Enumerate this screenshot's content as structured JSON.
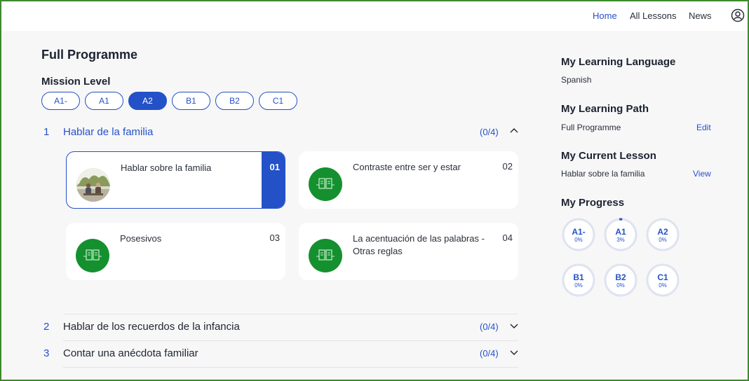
{
  "nav": {
    "home": "Home",
    "all_lessons": "All Lessons",
    "news": "News"
  },
  "programme": {
    "title": "Full Programme",
    "mission_level_label": "Mission Level",
    "levels": [
      "A1-",
      "A1",
      "A2",
      "B1",
      "B2",
      "C1"
    ],
    "selected_level": "A2"
  },
  "units": [
    {
      "num": "1",
      "title": "Hablar de la familia",
      "count": "(0/4)",
      "expanded": true,
      "lessons": [
        {
          "title": "Hablar sobre la familia",
          "num": "01",
          "active": true,
          "thumb": "family-photo"
        },
        {
          "title": "Contraste entre ser y estar",
          "num": "02",
          "active": false,
          "thumb": "book-icon"
        },
        {
          "title": "Posesivos",
          "num": "03",
          "active": false,
          "thumb": "book-icon"
        },
        {
          "title": "La acentuación de las palabras - Otras reglas",
          "num": "04",
          "active": false,
          "thumb": "book-icon"
        }
      ]
    },
    {
      "num": "2",
      "title": "Hablar de los recuerdos de la infancia",
      "count": "(0/4)",
      "expanded": false
    },
    {
      "num": "3",
      "title": "Contar una anécdota familiar",
      "count": "(0/4)",
      "expanded": false
    }
  ],
  "sidebar": {
    "language_heading": "My Learning Language",
    "language": "Spanish",
    "path_heading": "My Learning Path",
    "path": "Full Programme",
    "path_edit": "Edit",
    "lesson_heading": "My Current Lesson",
    "lesson": "Hablar sobre la familia",
    "lesson_view": "View",
    "progress_heading": "My Progress",
    "progress": [
      {
        "level": "A1-",
        "percent": "0%",
        "value": 0
      },
      {
        "level": "A1",
        "percent": "3%",
        "value": 3
      },
      {
        "level": "A2",
        "percent": "0%",
        "value": 0
      },
      {
        "level": "B1",
        "percent": "0%",
        "value": 0
      },
      {
        "level": "B2",
        "percent": "0%",
        "value": 0
      },
      {
        "level": "C1",
        "percent": "0%",
        "value": 0
      }
    ]
  },
  "colors": {
    "accent": "#2451c8",
    "icon_green": "#15902f",
    "frame_green": "#3f8a2e",
    "ring_track": "#dfe3ef"
  }
}
